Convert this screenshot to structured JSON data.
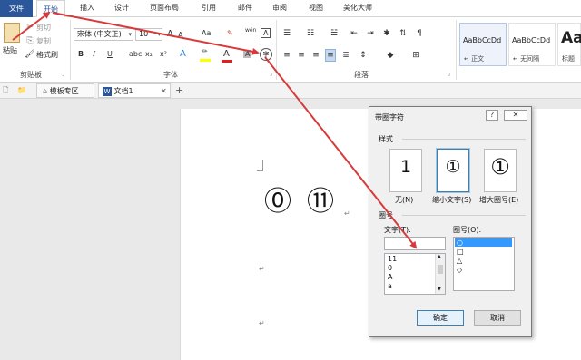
{
  "ribbon_tabs": {
    "file": "文件",
    "home": "开始",
    "insert": "插入",
    "design": "设计",
    "layout": "页面布局",
    "references": "引用",
    "mailings": "邮件",
    "review": "审阅",
    "view": "视图",
    "beautify": "美化大师"
  },
  "clipboard": {
    "paste": "粘贴",
    "cut": "剪切",
    "copy": "复制",
    "format_painter": "格式刷",
    "group_label": "剪贴板"
  },
  "font": {
    "font_name": "宋体 (中文正)",
    "font_size": "10",
    "group_label": "字体",
    "bold": "B",
    "italic": "I",
    "underline": "U",
    "strike": "abc",
    "subscript": "x₂",
    "superscript": "x²",
    "grow": "A",
    "shrink": "A",
    "case": "Aa",
    "font_color": "A",
    "wen": "wén",
    "char_border": "A",
    "enclose": "字"
  },
  "paragraph": {
    "group_label": "段落"
  },
  "styles": {
    "items": [
      {
        "sample": "AaBbCcDd",
        "name": "↵ 正文"
      },
      {
        "sample": "AaBbCcDd",
        "name": "↵ 无间隔"
      },
      {
        "sample": "Aa",
        "name": "标题"
      }
    ]
  },
  "doc_tabs": {
    "template": "模板专区",
    "document": "文档1",
    "close": "✕",
    "add": "+"
  },
  "document": {
    "glyph1": "⓪",
    "glyph2": "⑪",
    "pilcrow": "↵"
  },
  "dialog": {
    "title": "带圈字符",
    "help": "?",
    "close": "✕",
    "style_label": "样式",
    "options": [
      {
        "glyph": "1",
        "label": "无(N)"
      },
      {
        "glyph": "①",
        "label": "缩小文字(S)"
      },
      {
        "glyph": "①",
        "label": "增大圈号(E)"
      }
    ],
    "circle_label": "圈号",
    "text_label": "文字(T):",
    "text_value": "",
    "text_list": [
      "11",
      "0",
      "A",
      "a"
    ],
    "enclosure_label": "圈号(O):",
    "enclosure_list": [
      "○",
      "□",
      "△",
      "◇"
    ],
    "ok": "确定",
    "cancel": "取消"
  },
  "colors": {
    "accent": "#2b579a",
    "arrow": "#d63a3a",
    "highlight": "#3399ff"
  }
}
